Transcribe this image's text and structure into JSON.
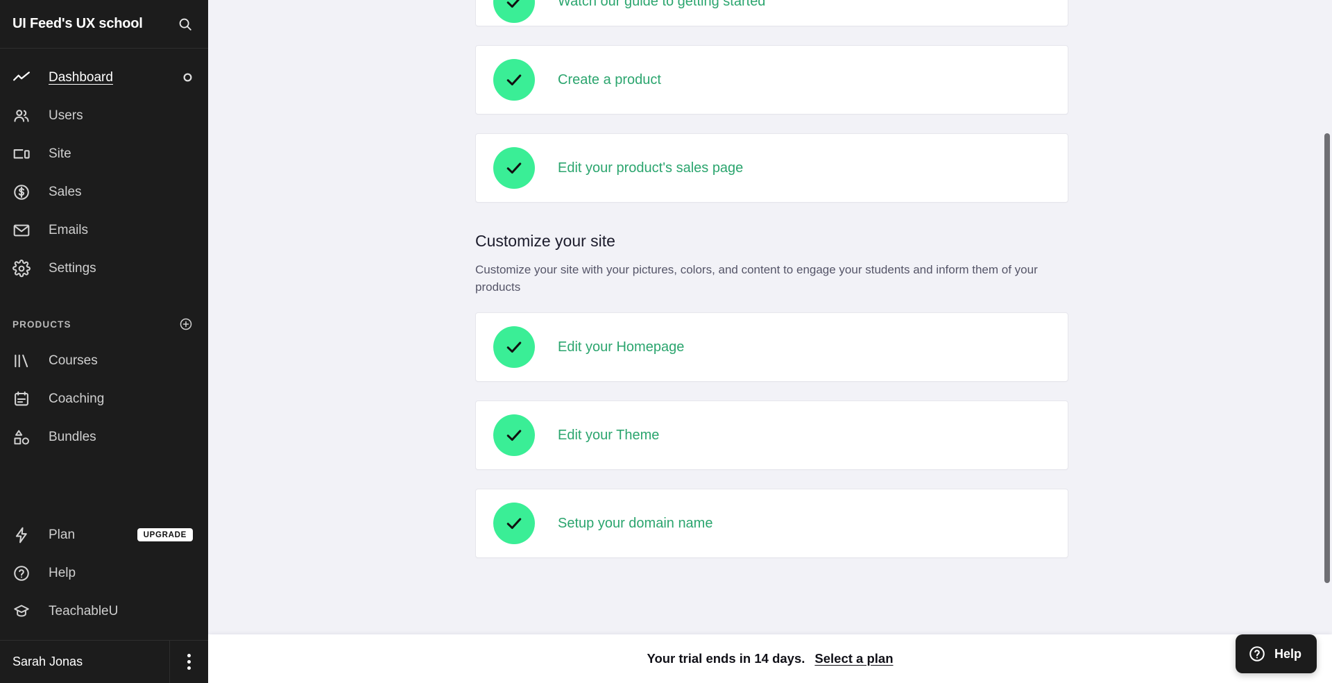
{
  "sidebar": {
    "title": "UI Feed's UX school",
    "search_icon": "search-icon",
    "nav": [
      {
        "label": "Dashboard",
        "icon": "trending-up-icon",
        "active": true,
        "right_icon": "ring-icon"
      },
      {
        "label": "Users",
        "icon": "users-icon",
        "active": false
      },
      {
        "label": "Site",
        "icon": "devices-icon",
        "active": false
      },
      {
        "label": "Sales",
        "icon": "dollar-circle-icon",
        "active": false
      },
      {
        "label": "Emails",
        "icon": "envelope-icon",
        "active": false
      },
      {
        "label": "Settings",
        "icon": "gear-icon",
        "active": false
      }
    ],
    "products_section": {
      "label": "PRODUCTS",
      "add_icon": "plus-circle-icon",
      "items": [
        {
          "label": "Courses",
          "icon": "books-icon"
        },
        {
          "label": "Coaching",
          "icon": "clipboard-icon"
        },
        {
          "label": "Bundles",
          "icon": "shapes-icon"
        }
      ]
    },
    "bottom": [
      {
        "label": "Plan",
        "icon": "bolt-icon",
        "badge": "UPGRADE"
      },
      {
        "label": "Help",
        "icon": "question-circle-icon"
      },
      {
        "label": "TeachableU",
        "icon": "graduation-cap-icon"
      }
    ],
    "footer": {
      "user_name": "Sarah Jonas",
      "menu_icon": "kebab-menu-icon"
    }
  },
  "main": {
    "top_cards": [
      {
        "label": "Watch our guide to getting started",
        "state": "complete",
        "icon": "check-icon"
      },
      {
        "label": "Create a product",
        "state": "complete",
        "icon": "check-icon"
      },
      {
        "label": "Edit your product's sales page",
        "state": "complete",
        "icon": "check-icon"
      }
    ],
    "customize_section": {
      "title": "Customize your site",
      "description": "Customize your site with your pictures, colors, and content to engage your students and inform them of your products",
      "cards": [
        {
          "label": "Edit your Homepage",
          "state": "complete",
          "icon": "check-icon"
        },
        {
          "label": "Edit your Theme",
          "state": "complete",
          "icon": "check-icon"
        },
        {
          "label": "Setup your domain name",
          "state": "complete",
          "icon": "check-icon"
        }
      ]
    }
  },
  "trial_bar": {
    "message": "Your trial ends in 14 days.",
    "link_label": "Select a plan"
  },
  "help_widget": {
    "label": "Help",
    "icon": "question-circle-icon"
  },
  "colors": {
    "accent_green": "#3AEE96",
    "link_green": "#2ba56e",
    "sidebar_bg": "#1c1c1c",
    "page_bg": "#f2f2f7"
  }
}
